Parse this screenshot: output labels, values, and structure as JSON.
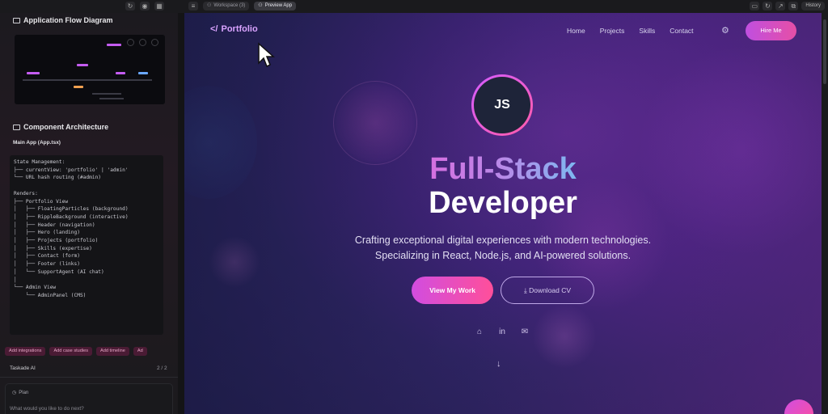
{
  "topbar": {
    "workspace_label": "Workspace (3)",
    "preview_label": "Preview App",
    "history_label": "History"
  },
  "left_panel": {
    "diagram_title": "Application Flow Diagram",
    "components_title": "Component Architecture",
    "main_app_label": "Main App (App.tsx)",
    "code_lines": [
      "State Management:",
      "├── currentView: 'portfolio' | 'admin'",
      "└── URL hash routing (#admin)",
      "",
      "Renders:",
      "├── Portfolio View",
      "│   ├── FloatingParticles (background)",
      "│   ├── RippleBackground (interactive)",
      "│   ├── Header (navigation)",
      "│   ├── Hero (landing)",
      "│   ├── Projects (portfolio)",
      "│   ├── Skills (expertise)",
      "│   ├── Contact (form)",
      "│   ├── Footer (links)",
      "│   └── SupportAgent (AI chat)",
      "│",
      "└── Admin View",
      "    └── AdminPanel (CMS)"
    ],
    "chips": [
      "Add integrations",
      "Add case studies",
      "Add timeline",
      "Ad"
    ],
    "task_label": "Taskade AI",
    "task_count": "2 / 2",
    "composer_mode": "Plan",
    "composer_placeholder": "What would you like to do next?"
  },
  "preview": {
    "logo_text": "Portfolio",
    "nav_links": [
      "Home",
      "Projects",
      "Skills",
      "Contact"
    ],
    "hire_button": "Hire Me",
    "avatar_initials": "JS",
    "headline_gradient": "Full-Stack",
    "headline_white": "Developer",
    "subtitle_line1": "Crafting exceptional digital experiences with modern technologies.",
    "subtitle_line2": "Specializing in React, Node.js, and AI-powered solutions.",
    "primary_button": "View My Work",
    "secondary_button": "Download CV",
    "colors": {
      "accent_pink": "#e64fa6",
      "accent_purple": "#c04fe0",
      "avatar_bg": "#1e2439"
    }
  },
  "icons": [
    "github-icon",
    "linkedin-icon",
    "mail-icon",
    "arrow-down-icon",
    "settings-icon",
    "download-icon"
  ]
}
